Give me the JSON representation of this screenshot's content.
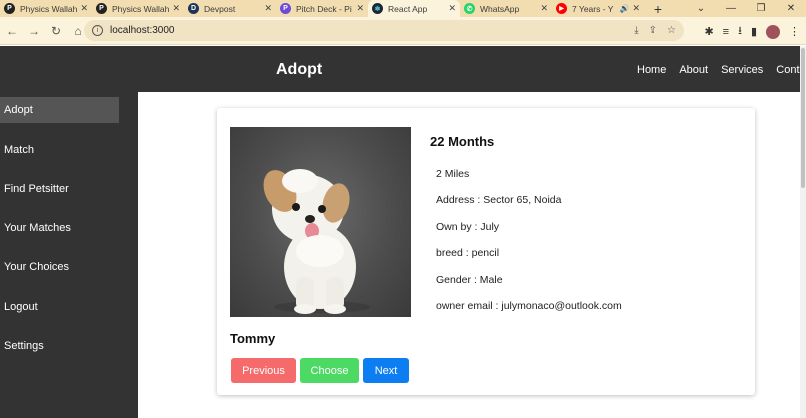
{
  "browser": {
    "tabs": [
      {
        "title": "Physics Wallah",
        "fav_color": "#222222",
        "fav_glyph": "P"
      },
      {
        "title": "Physics Wallah",
        "fav_color": "#222222",
        "fav_glyph": "P"
      },
      {
        "title": "Devpost",
        "fav_color": "#1d3557",
        "fav_glyph": "D"
      },
      {
        "title": "Pitch Deck - Pi",
        "fav_color": "#6c4bd6",
        "fav_glyph": "P"
      },
      {
        "title": "React App",
        "fav_color": "#1c2833",
        "fav_glyph": "⚛"
      },
      {
        "title": "WhatsApp",
        "fav_color": "#25d366",
        "fav_glyph": "✆"
      },
      {
        "title": "7 Years - Y",
        "fav_color": "#ff0000",
        "fav_glyph": "▶"
      }
    ],
    "active_tab": 4,
    "url": "localhost:3000",
    "new_tab_glyph": "+",
    "window_controls": [
      "⌄",
      "—",
      "❐",
      "✕"
    ]
  },
  "app": {
    "title": "Adopt",
    "top_nav": [
      "Home",
      "About",
      "Services",
      "Contact"
    ],
    "sidebar": [
      "Adopt",
      "Match",
      "Find Petsitter",
      "Your Matches",
      "Your Choices",
      "Logout",
      "Settings"
    ],
    "sidebar_active": 0
  },
  "pet": {
    "name": "Tommy",
    "age": "22 Months",
    "distance": "2 Miles",
    "address": "Address : Sector 65, Noida",
    "owner": "Own by : July",
    "breed": "breed : pencil",
    "gender": "Gender : Male",
    "owner_email": "owner email : julymonaco@outlook.com"
  },
  "actions": {
    "previous": "Previous",
    "choose": "Choose",
    "next": "Next"
  },
  "colors": {
    "header_bg": "#333333",
    "sidebar_active_bg": "#555555",
    "previous_btn": "#f56a6a",
    "choose_btn": "#4cd964",
    "next_btn": "#0d7ef2",
    "tabbar_bg": "#f1ddb0"
  }
}
